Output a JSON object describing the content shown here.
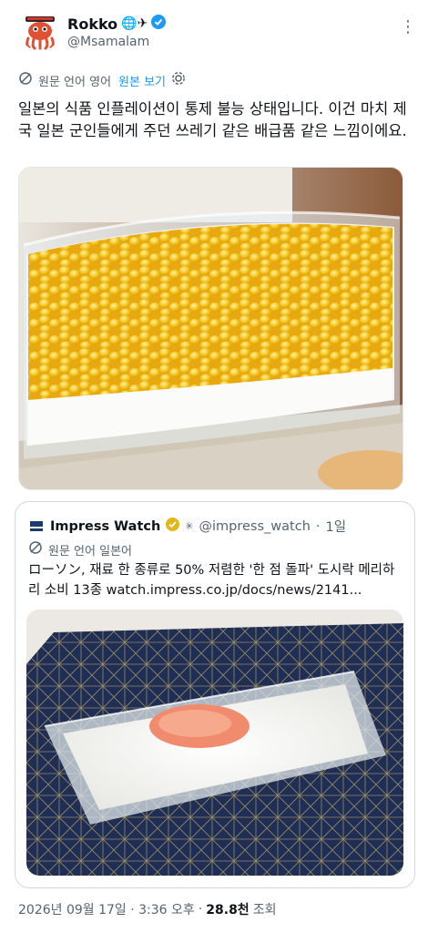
{
  "author": {
    "display_name": "Rokko",
    "handle": "@Msamalam",
    "emoji": "🌐✈"
  },
  "translation": {
    "source_label": "원문 언어 영어",
    "show_original": "원본 보기"
  },
  "tweet": {
    "text": "일본의 식품 인플레이션이 통제 불능 상태입니다. 이건 마치 제국 일본 군인들에게 주던 쓰레기 같은 배급품 같은 느낌이에요."
  },
  "quoted": {
    "name": "Impress Watch",
    "handle": "@impress_watch",
    "separator": "·",
    "time": "1일",
    "translation_label": "원문 언어 일본어",
    "text": "ローソン, 재료 한 종류로 50% 저렴한 '한 점 돌파' 도시락 메리하리 소비 13종 watch.impress.co.jp/docs/news/2141..."
  },
  "footer": {
    "timestamp": "2026년 09월 17일 · 3:36 오후",
    "separator": "·",
    "views_count": "28.8천",
    "views_label": "조회"
  },
  "colors": {
    "accent": "#1d9bf0",
    "verified": "#1d9bf0",
    "gold_verified": "#e2b719",
    "muted": "#536471"
  }
}
